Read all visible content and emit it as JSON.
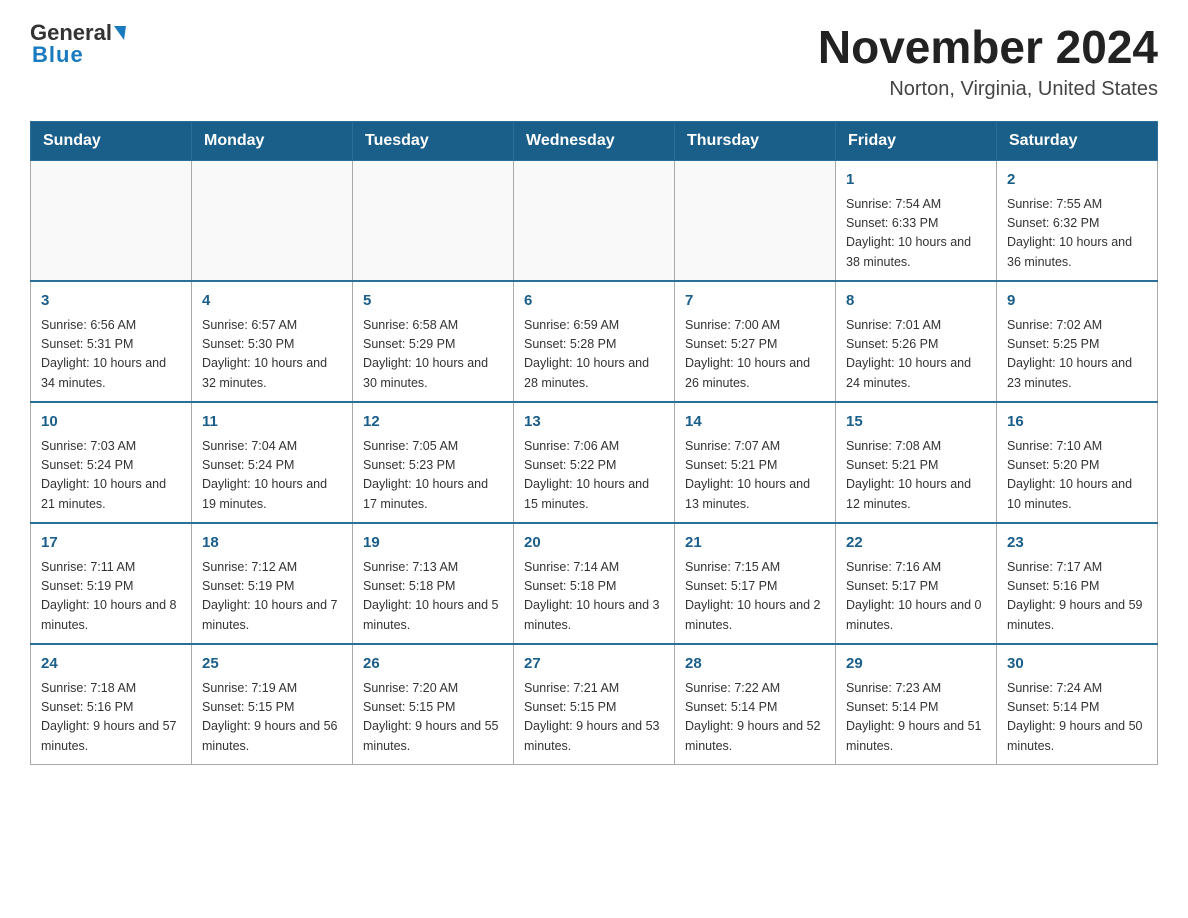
{
  "header": {
    "logo_general": "General",
    "logo_blue": "Blue",
    "title": "November 2024",
    "location": "Norton, Virginia, United States"
  },
  "days_of_week": [
    "Sunday",
    "Monday",
    "Tuesday",
    "Wednesday",
    "Thursday",
    "Friday",
    "Saturday"
  ],
  "weeks": [
    [
      {
        "day": "",
        "info": ""
      },
      {
        "day": "",
        "info": ""
      },
      {
        "day": "",
        "info": ""
      },
      {
        "day": "",
        "info": ""
      },
      {
        "day": "",
        "info": ""
      },
      {
        "day": "1",
        "info": "Sunrise: 7:54 AM\nSunset: 6:33 PM\nDaylight: 10 hours and 38 minutes."
      },
      {
        "day": "2",
        "info": "Sunrise: 7:55 AM\nSunset: 6:32 PM\nDaylight: 10 hours and 36 minutes."
      }
    ],
    [
      {
        "day": "3",
        "info": "Sunrise: 6:56 AM\nSunset: 5:31 PM\nDaylight: 10 hours and 34 minutes."
      },
      {
        "day": "4",
        "info": "Sunrise: 6:57 AM\nSunset: 5:30 PM\nDaylight: 10 hours and 32 minutes."
      },
      {
        "day": "5",
        "info": "Sunrise: 6:58 AM\nSunset: 5:29 PM\nDaylight: 10 hours and 30 minutes."
      },
      {
        "day": "6",
        "info": "Sunrise: 6:59 AM\nSunset: 5:28 PM\nDaylight: 10 hours and 28 minutes."
      },
      {
        "day": "7",
        "info": "Sunrise: 7:00 AM\nSunset: 5:27 PM\nDaylight: 10 hours and 26 minutes."
      },
      {
        "day": "8",
        "info": "Sunrise: 7:01 AM\nSunset: 5:26 PM\nDaylight: 10 hours and 24 minutes."
      },
      {
        "day": "9",
        "info": "Sunrise: 7:02 AM\nSunset: 5:25 PM\nDaylight: 10 hours and 23 minutes."
      }
    ],
    [
      {
        "day": "10",
        "info": "Sunrise: 7:03 AM\nSunset: 5:24 PM\nDaylight: 10 hours and 21 minutes."
      },
      {
        "day": "11",
        "info": "Sunrise: 7:04 AM\nSunset: 5:24 PM\nDaylight: 10 hours and 19 minutes."
      },
      {
        "day": "12",
        "info": "Sunrise: 7:05 AM\nSunset: 5:23 PM\nDaylight: 10 hours and 17 minutes."
      },
      {
        "day": "13",
        "info": "Sunrise: 7:06 AM\nSunset: 5:22 PM\nDaylight: 10 hours and 15 minutes."
      },
      {
        "day": "14",
        "info": "Sunrise: 7:07 AM\nSunset: 5:21 PM\nDaylight: 10 hours and 13 minutes."
      },
      {
        "day": "15",
        "info": "Sunrise: 7:08 AM\nSunset: 5:21 PM\nDaylight: 10 hours and 12 minutes."
      },
      {
        "day": "16",
        "info": "Sunrise: 7:10 AM\nSunset: 5:20 PM\nDaylight: 10 hours and 10 minutes."
      }
    ],
    [
      {
        "day": "17",
        "info": "Sunrise: 7:11 AM\nSunset: 5:19 PM\nDaylight: 10 hours and 8 minutes."
      },
      {
        "day": "18",
        "info": "Sunrise: 7:12 AM\nSunset: 5:19 PM\nDaylight: 10 hours and 7 minutes."
      },
      {
        "day": "19",
        "info": "Sunrise: 7:13 AM\nSunset: 5:18 PM\nDaylight: 10 hours and 5 minutes."
      },
      {
        "day": "20",
        "info": "Sunrise: 7:14 AM\nSunset: 5:18 PM\nDaylight: 10 hours and 3 minutes."
      },
      {
        "day": "21",
        "info": "Sunrise: 7:15 AM\nSunset: 5:17 PM\nDaylight: 10 hours and 2 minutes."
      },
      {
        "day": "22",
        "info": "Sunrise: 7:16 AM\nSunset: 5:17 PM\nDaylight: 10 hours and 0 minutes."
      },
      {
        "day": "23",
        "info": "Sunrise: 7:17 AM\nSunset: 5:16 PM\nDaylight: 9 hours and 59 minutes."
      }
    ],
    [
      {
        "day": "24",
        "info": "Sunrise: 7:18 AM\nSunset: 5:16 PM\nDaylight: 9 hours and 57 minutes."
      },
      {
        "day": "25",
        "info": "Sunrise: 7:19 AM\nSunset: 5:15 PM\nDaylight: 9 hours and 56 minutes."
      },
      {
        "day": "26",
        "info": "Sunrise: 7:20 AM\nSunset: 5:15 PM\nDaylight: 9 hours and 55 minutes."
      },
      {
        "day": "27",
        "info": "Sunrise: 7:21 AM\nSunset: 5:15 PM\nDaylight: 9 hours and 53 minutes."
      },
      {
        "day": "28",
        "info": "Sunrise: 7:22 AM\nSunset: 5:14 PM\nDaylight: 9 hours and 52 minutes."
      },
      {
        "day": "29",
        "info": "Sunrise: 7:23 AM\nSunset: 5:14 PM\nDaylight: 9 hours and 51 minutes."
      },
      {
        "day": "30",
        "info": "Sunrise: 7:24 AM\nSunset: 5:14 PM\nDaylight: 9 hours and 50 minutes."
      }
    ]
  ]
}
